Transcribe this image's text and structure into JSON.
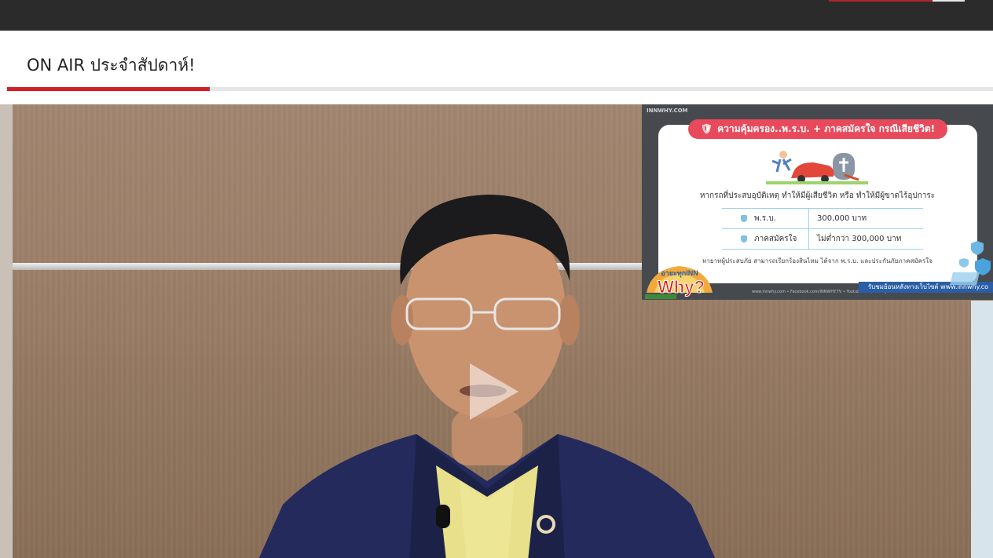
{
  "section": {
    "title": "ON AIR ประจำสัปดาห์!"
  },
  "overlay": {
    "site": "INNWHY.COM",
    "banner": "ความคุ้มครอง..พ.ร.บ. + ภาคสมัครใจ กรณีเสียชีวิต!",
    "question": "หากรถที่ประสบอุบัติเหตุ ทำให้มีผู้เสียชีวิต หรือ ทำให้มีผู้ขาดไร้อุปการะ",
    "rows": [
      {
        "label": "พ.ร.บ.",
        "value": "300,000 บาท"
      },
      {
        "label": "ภาคสมัครใจ",
        "value": "ไม่ต่ำกว่า 300,000 บาท"
      }
    ],
    "note": "ทายาทผู้ประสบภัย สามารถเรียกร้องสินไหม ได้จาก พ.ร.บ. และประกันภัยภาคสมัครใจ",
    "logo_text_top": "อายะทุกINN",
    "logo_text_main": "Why?",
    "footer_links": "www.innwhy.com  •  Facebook.com/INNWHY.TV  •  Youtube.com/innwhy",
    "footer_badge": "รับชมย้อนหลังทางเว็บไซต์ www.innwhy.co"
  },
  "colors": {
    "accent": "#d11f27",
    "banner": "#e84a5c",
    "overlay_bg": "#464a4f",
    "table_line": "#9fd2e8",
    "badge": "#2a5fa8"
  }
}
